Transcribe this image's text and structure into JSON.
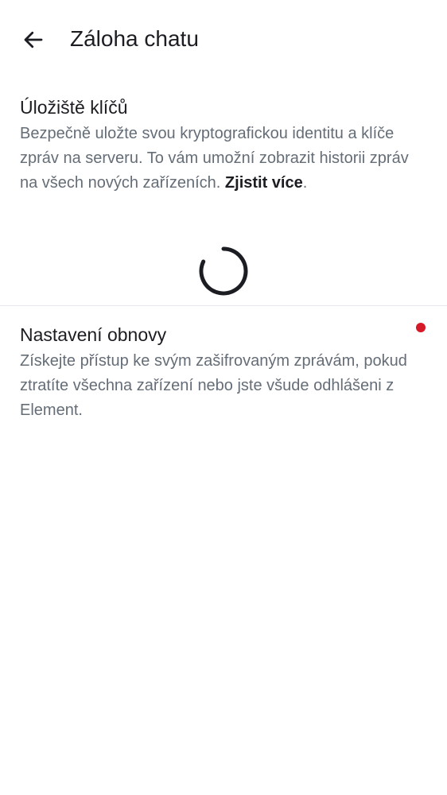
{
  "header": {
    "title": "Záloha chatu",
    "back_icon": "arrow-left-icon"
  },
  "key_storage": {
    "heading": "Úložiště klíčů",
    "description": "Bezpečně uložte svou kryptografickou identitu a klíče zpráv na serveru. To vám umožní zobrazit historii zpráv na všech nových zařízeních.",
    "learn_more": "Zjistit více",
    "suffix": ".",
    "loading_icon": "spinner-icon"
  },
  "recovery": {
    "heading": "Nastavení obnovy",
    "description": "Získejte přístup ke svým zašifrovaným zprávám, pokud ztratíte všechna zařízení nebo jste všude odhlášeni z Element.",
    "badge_color": "#d51928"
  },
  "colors": {
    "primary_text": "#1b1d22",
    "secondary_text": "#656d77",
    "divider": "#e6e8eb",
    "alert": "#d51928"
  }
}
